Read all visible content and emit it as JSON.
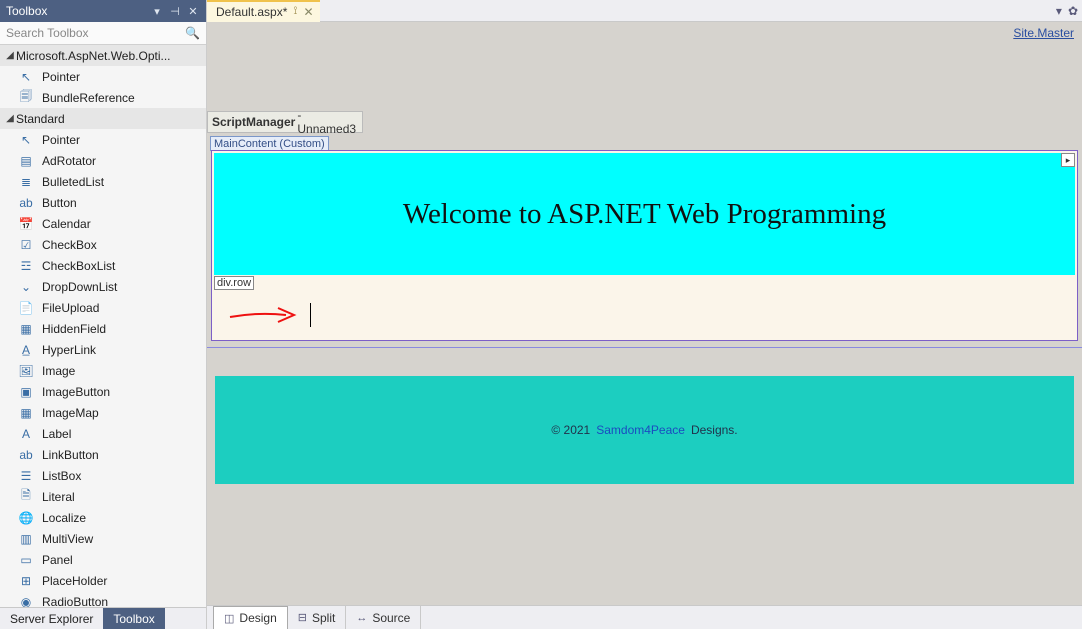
{
  "toolbox": {
    "title": "Toolbox",
    "search_placeholder": "Search Toolbox",
    "groups": [
      {
        "label": "Microsoft.AspNet.Web.Opti...",
        "items": [
          {
            "icon": "↖",
            "label": "Pointer"
          },
          {
            "icon": "🗐",
            "label": "BundleReference"
          }
        ]
      },
      {
        "label": "Standard",
        "items": [
          {
            "icon": "↖",
            "label": "Pointer"
          },
          {
            "icon": "▤",
            "label": "AdRotator"
          },
          {
            "icon": "≣",
            "label": "BulletedList"
          },
          {
            "icon": "ab",
            "label": "Button"
          },
          {
            "icon": "📅",
            "label": "Calendar"
          },
          {
            "icon": "☑",
            "label": "CheckBox"
          },
          {
            "icon": "☲",
            "label": "CheckBoxList"
          },
          {
            "icon": "⌄",
            "label": "DropDownList"
          },
          {
            "icon": "📄",
            "label": "FileUpload"
          },
          {
            "icon": "▦",
            "label": "HiddenField"
          },
          {
            "icon": "A̲",
            "label": "HyperLink"
          },
          {
            "icon": "🖼",
            "label": "Image"
          },
          {
            "icon": "▣",
            "label": "ImageButton"
          },
          {
            "icon": "▦",
            "label": "ImageMap"
          },
          {
            "icon": "A",
            "label": "Label"
          },
          {
            "icon": "ab",
            "label": "LinkButton"
          },
          {
            "icon": "☰",
            "label": "ListBox"
          },
          {
            "icon": "🗎",
            "label": "Literal"
          },
          {
            "icon": "🌐",
            "label": "Localize"
          },
          {
            "icon": "▥",
            "label": "MultiView"
          },
          {
            "icon": "▭",
            "label": "Panel"
          },
          {
            "icon": "⊞",
            "label": "PlaceHolder"
          },
          {
            "icon": "◉",
            "label": "RadioButton"
          }
        ]
      }
    ]
  },
  "bottom_panel_tabs": [
    {
      "label": "Server Explorer",
      "active": false
    },
    {
      "label": "Toolbox",
      "active": true
    }
  ],
  "document_tabs": {
    "active": {
      "label": "Default.aspx*"
    }
  },
  "designer": {
    "site_master_link": "Site.Master",
    "script_manager": {
      "bold": "ScriptManager",
      "rest": " - Unnamed3"
    },
    "main_content_tag": "MainContent (Custom)",
    "hero_heading": "Welcome to ASP.NET Web Programming",
    "row_tag": "div.row",
    "footer": {
      "prefix": "© 2021 ",
      "brand": "Samdom4Peace",
      "suffix": "  Designs."
    }
  },
  "view_tabs": [
    {
      "icon": "◫",
      "label": "Design",
      "active": true
    },
    {
      "icon": "⊟",
      "label": "Split",
      "active": false
    },
    {
      "icon": "↔",
      "label": "Source",
      "active": false
    }
  ]
}
